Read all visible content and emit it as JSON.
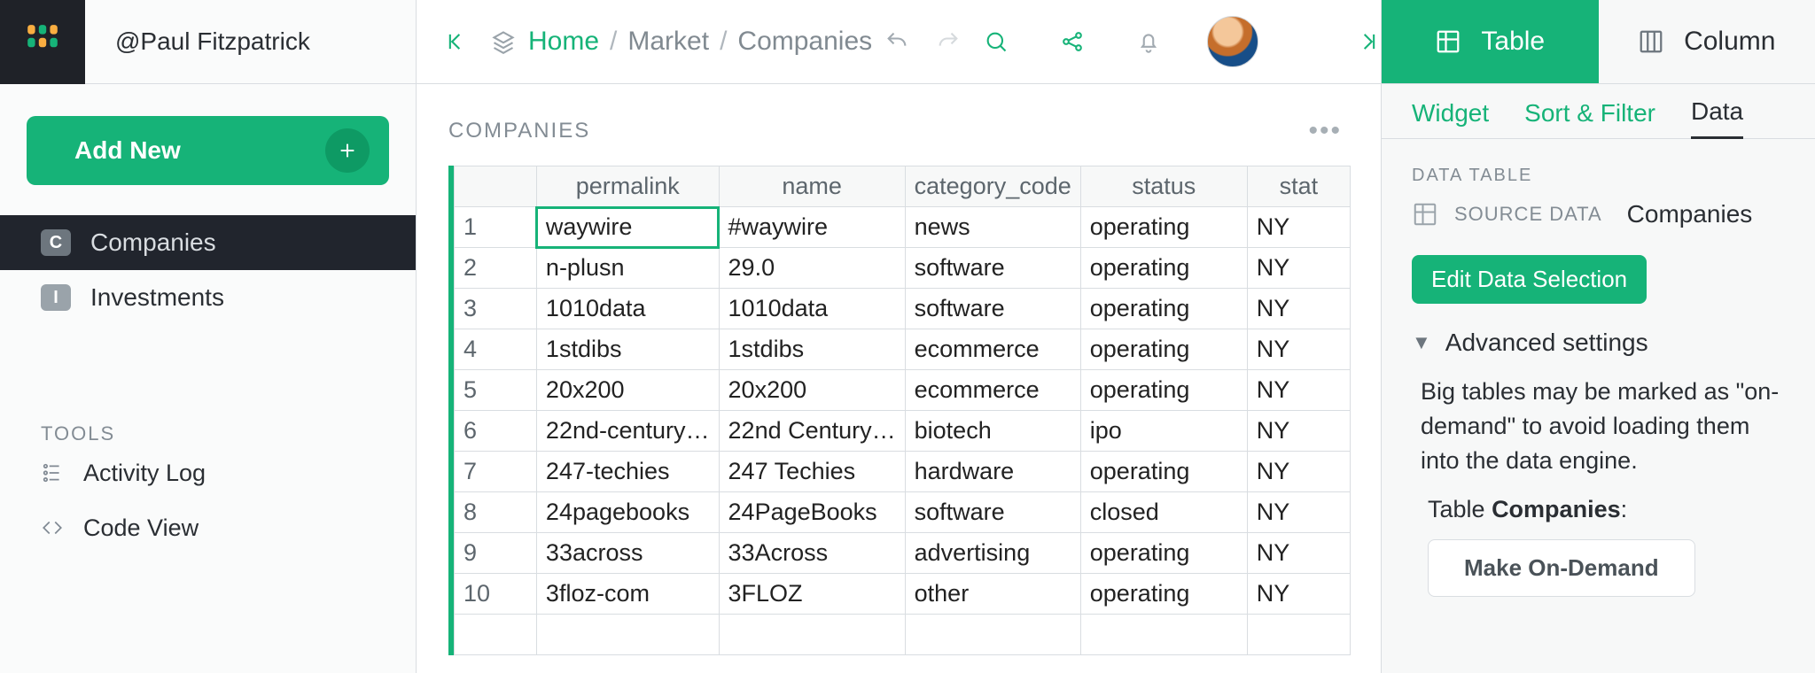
{
  "user": {
    "handle": "@Paul Fitzpatrick"
  },
  "sidebar": {
    "add_new": "Add New",
    "pages": [
      {
        "chip": "C",
        "label": "Companies",
        "active": true
      },
      {
        "chip": "I",
        "label": "Investments",
        "active": false
      }
    ],
    "tools_label": "TOOLS",
    "tools": [
      {
        "label": "Activity Log"
      },
      {
        "label": "Code View"
      }
    ]
  },
  "breadcrumb": {
    "home": "Home",
    "market": "Market",
    "page": "Companies"
  },
  "section": {
    "title": "COMPANIES",
    "columns": [
      "permalink",
      "name",
      "category_code",
      "status",
      "stat"
    ],
    "rows": [
      {
        "n": 1,
        "permalink": "waywire",
        "name": "#waywire",
        "category_code": "news",
        "status": "operating",
        "state": "NY"
      },
      {
        "n": 2,
        "permalink": "n-plusn",
        "name": "29.0",
        "category_code": "software",
        "status": "operating",
        "state": "NY"
      },
      {
        "n": 3,
        "permalink": "1010data",
        "name": "1010data",
        "category_code": "software",
        "status": "operating",
        "state": "NY"
      },
      {
        "n": 4,
        "permalink": "1stdibs",
        "name": "1stdibs",
        "category_code": "ecommerce",
        "status": "operating",
        "state": "NY"
      },
      {
        "n": 5,
        "permalink": "20x200",
        "name": "20x200",
        "category_code": "ecommerce",
        "status": "operating",
        "state": "NY"
      },
      {
        "n": 6,
        "permalink": "22nd-century…",
        "name": "22nd Century…",
        "category_code": "biotech",
        "status": "ipo",
        "state": "NY"
      },
      {
        "n": 7,
        "permalink": "247-techies",
        "name": "247 Techies",
        "category_code": "hardware",
        "status": "operating",
        "state": "NY"
      },
      {
        "n": 8,
        "permalink": "24pagebooks",
        "name": "24PageBooks",
        "category_code": "software",
        "status": "closed",
        "state": "NY"
      },
      {
        "n": 9,
        "permalink": "33across",
        "name": "33Across",
        "category_code": "advertising",
        "status": "operating",
        "state": "NY"
      },
      {
        "n": 10,
        "permalink": "3floz-com",
        "name": "3FLOZ",
        "category_code": "other",
        "status": "operating",
        "state": "NY"
      }
    ],
    "active_row": 1,
    "active_col": "permalink"
  },
  "right": {
    "tabs": {
      "table": "Table",
      "column": "Column"
    },
    "subtabs": {
      "widget": "Widget",
      "sort": "Sort & Filter",
      "data": "Data"
    },
    "data_table_label": "DATA TABLE",
    "source_data_label": "SOURCE DATA",
    "source_data_value": "Companies",
    "edit_btn": "Edit Data Selection",
    "advanced": "Advanced settings",
    "note": "Big tables may be marked as \"on-demand\" to avoid loading them into the data engine.",
    "table_text_prefix": "Table ",
    "table_text_name": "Companies",
    "table_text_suffix": ":",
    "ondemand_btn": "Make On-Demand"
  }
}
